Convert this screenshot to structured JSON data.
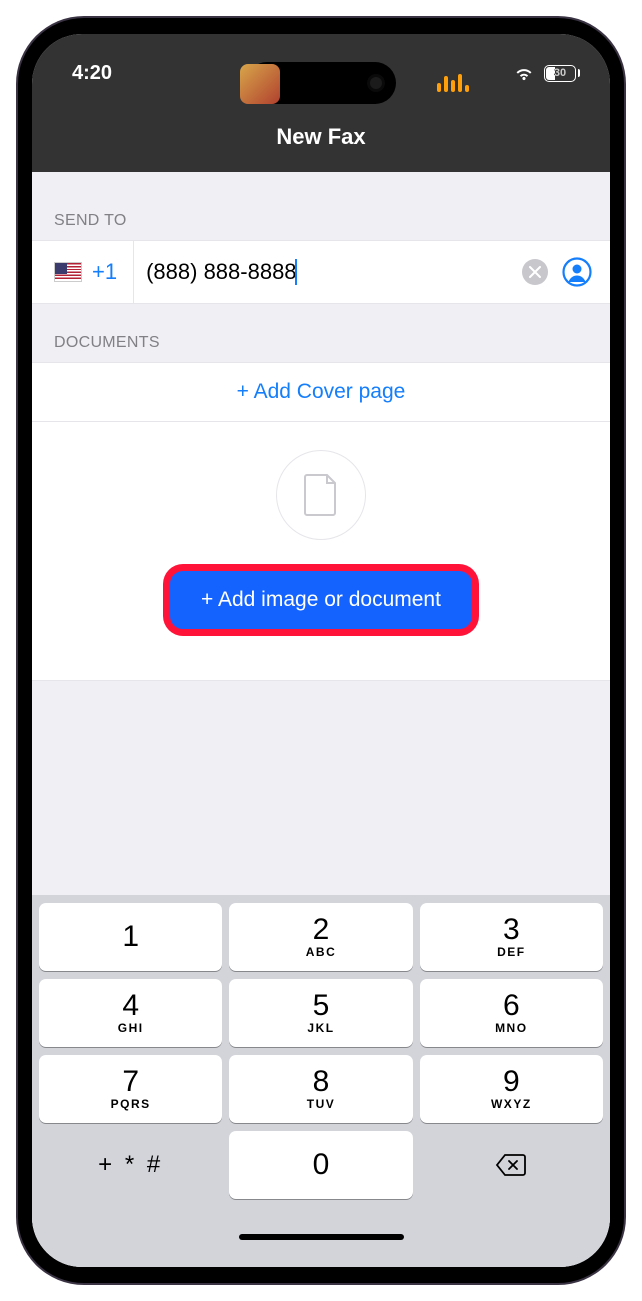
{
  "status": {
    "time": "4:20",
    "battery_pct": "30"
  },
  "nav": {
    "title": "New Fax"
  },
  "send_to": {
    "label": "SEND TO",
    "country_code": "+1",
    "phone_value": "(888) 888-8888"
  },
  "documents": {
    "label": "DOCUMENTS",
    "add_cover": "+ Add Cover page",
    "add_doc": "+ Add image or document"
  },
  "keypad": {
    "r1": [
      {
        "n": "1",
        "l": ""
      },
      {
        "n": "2",
        "l": "ABC"
      },
      {
        "n": "3",
        "l": "DEF"
      }
    ],
    "r2": [
      {
        "n": "4",
        "l": "GHI"
      },
      {
        "n": "5",
        "l": "JKL"
      },
      {
        "n": "6",
        "l": "MNO"
      }
    ],
    "r3": [
      {
        "n": "7",
        "l": "PQRS"
      },
      {
        "n": "8",
        "l": "TUV"
      },
      {
        "n": "9",
        "l": "WXYZ"
      }
    ],
    "r4": {
      "sym": "+ * #",
      "zero": "0"
    }
  }
}
